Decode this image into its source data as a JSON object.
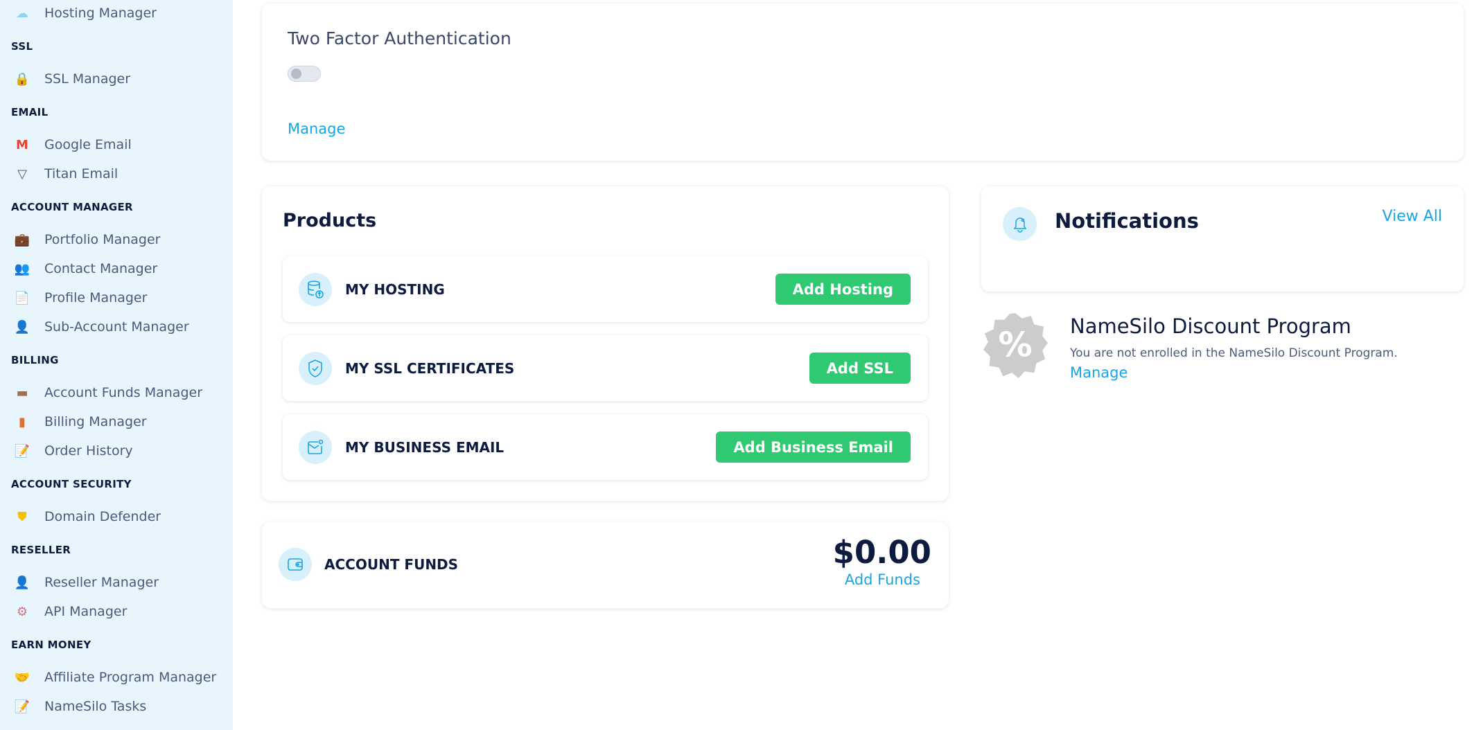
{
  "sidebar": {
    "entries": [
      {
        "type": "item",
        "label": "Hosting Manager",
        "icon": "cloud-hosting-icon",
        "glyph": "☁",
        "color": "#8fd3f4"
      },
      {
        "type": "header",
        "label": "SSL"
      },
      {
        "type": "item",
        "label": "SSL Manager",
        "icon": "padlock-icon",
        "glyph": "🔒",
        "color": "#f5b800"
      },
      {
        "type": "header",
        "label": "EMAIL"
      },
      {
        "type": "item",
        "label": "Google Email",
        "icon": "gmail-icon",
        "glyph": "M",
        "color": "#ea4335"
      },
      {
        "type": "item",
        "label": "Titan Email",
        "icon": "titan-icon",
        "glyph": "▽",
        "color": "#4b5a7a"
      },
      {
        "type": "header",
        "label": "ACCOUNT MANAGER"
      },
      {
        "type": "item",
        "label": "Portfolio Manager",
        "icon": "briefcase-icon",
        "glyph": "💼",
        "color": "#7a5a3a"
      },
      {
        "type": "item",
        "label": "Contact Manager",
        "icon": "contacts-icon",
        "glyph": "👥",
        "color": "#c87a50"
      },
      {
        "type": "item",
        "label": "Profile Manager",
        "icon": "document-icon",
        "glyph": "📄",
        "color": "#d8d2b0"
      },
      {
        "type": "item",
        "label": "Sub-Account Manager",
        "icon": "user-gear-icon",
        "glyph": "👤",
        "color": "#6b7fc0"
      },
      {
        "type": "header",
        "label": "BILLING"
      },
      {
        "type": "item",
        "label": "Account Funds Manager",
        "icon": "wallet-icon",
        "glyph": "▬",
        "color": "#a0704a"
      },
      {
        "type": "item",
        "label": "Billing Manager",
        "icon": "invoice-icon",
        "glyph": "▮",
        "color": "#e07030"
      },
      {
        "type": "item",
        "label": "Order History",
        "icon": "checklist-icon",
        "glyph": "📝",
        "color": "#c04040"
      },
      {
        "type": "header",
        "label": "ACCOUNT SECURITY"
      },
      {
        "type": "item",
        "label": "Domain Defender",
        "icon": "shield-icon",
        "glyph": "⛊",
        "color": "#f5c000"
      },
      {
        "type": "header",
        "label": "RESELLER"
      },
      {
        "type": "item",
        "label": "Reseller Manager",
        "icon": "businessman-icon",
        "glyph": "👤",
        "color": "#2d3a50"
      },
      {
        "type": "item",
        "label": "API Manager",
        "icon": "api-gear-icon",
        "glyph": "⚙",
        "color": "#d07080"
      },
      {
        "type": "header",
        "label": "EARN MONEY"
      },
      {
        "type": "item",
        "label": "Affiliate Program Manager",
        "icon": "handshake-icon",
        "glyph": "🤝",
        "color": "#e0a070"
      },
      {
        "type": "item",
        "label": "NameSilo Tasks",
        "icon": "tasks-icon",
        "glyph": "📝",
        "color": "#40a080"
      }
    ]
  },
  "two_factor": {
    "title": "Two Factor Authentication",
    "enabled": false,
    "manage_label": "Manage"
  },
  "products": {
    "title": "Products",
    "rows": [
      {
        "label": "MY HOSTING",
        "button": "Add Hosting",
        "icon": "database-icon"
      },
      {
        "label": "MY SSL CERTIFICATES",
        "button": "Add SSL",
        "icon": "shield-check-icon"
      },
      {
        "label": "MY BUSINESS EMAIL",
        "button": "Add Business Email",
        "icon": "mail-icon"
      }
    ]
  },
  "funds": {
    "label": "ACCOUNT FUNDS",
    "amount": "$0.00",
    "add_label": "Add Funds"
  },
  "notifications": {
    "title": "Notifications",
    "view_all": "View All"
  },
  "discount": {
    "title": "NameSilo Discount Program",
    "text": "You are not enrolled in the NameSilo Discount Program.",
    "manage_label": "Manage"
  },
  "colors": {
    "accent": "#17a5e6",
    "button": "#2ec971",
    "sidebar_bg": "#e9f5fc",
    "heading": "#0d1b3e"
  }
}
